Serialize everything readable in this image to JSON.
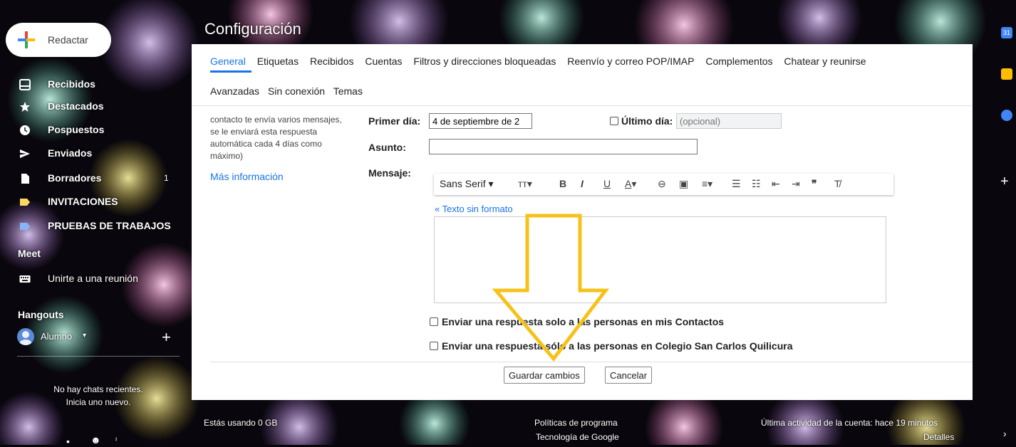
{
  "compose": {
    "label": "Redactar"
  },
  "sidebar": {
    "items": [
      {
        "label": "Recibidos",
        "icon": "inbox-icon"
      },
      {
        "label": "Destacados",
        "icon": "star-icon"
      },
      {
        "label": "Pospuestos",
        "icon": "clock-icon"
      },
      {
        "label": "Enviados",
        "icon": "send-icon"
      },
      {
        "label": "Borradores",
        "count": "1",
        "icon": "draft-icon"
      },
      {
        "label": "INVITACIONES",
        "icon": "label-icon",
        "color": "#fdd663"
      },
      {
        "label": "PRUEBAS DE TRABAJOS",
        "icon": "label-icon",
        "color": "#8ab4f8"
      }
    ],
    "meet_title": "Meet",
    "meet_item": "Unirte a una reunión",
    "hangouts_title": "Hangouts",
    "user_name": "Alumno",
    "no_chats_line1": "No hay chats recientes.",
    "no_chats_line2": "Inicia uno nuevo."
  },
  "settings": {
    "title": "Configuración",
    "tabs_row1": [
      "General",
      "Etiquetas",
      "Recibidos",
      "Cuentas",
      "Filtros y direcciones bloqueadas",
      "Reenvío y correo POP/IMAP",
      "Complementos",
      "Chatear y reunirse"
    ],
    "tabs_row2": [
      "Avanzadas",
      "Sin conexión",
      "Temas"
    ],
    "description": [
      "contacto te envía varios mensajes,",
      "se le enviará esta respuesta",
      "automática cada 4 días como",
      "máximo)"
    ],
    "more_info": "Más información",
    "first_day_label": "Primer día:",
    "first_day_value": "4 de septiembre de 2",
    "last_day_label": "Último día:",
    "last_day_placeholder": "(opcional)",
    "subject_label": "Asunto:",
    "message_label": "Mensaje:",
    "font_name": "Sans Serif",
    "plain_text_link": "« Texto sin formato",
    "option1": "Enviar una respuesta solo a las personas en mis Contactos",
    "option2": "Enviar una respuesta sólo a las personas en Colegio San Carlos Quilicura",
    "save_button": "Guardar cambios",
    "cancel_button": "Cancelar"
  },
  "footer": {
    "storage": "Estás usando 0 GB",
    "policies": "Políticas de programa",
    "tech": "Tecnología de Google",
    "activity": "Última actividad de la cuenta: hace 19 minutos",
    "details": "Detalles"
  },
  "colors": {
    "accent": "#1a73e8",
    "arrow": "#f6c21a"
  }
}
